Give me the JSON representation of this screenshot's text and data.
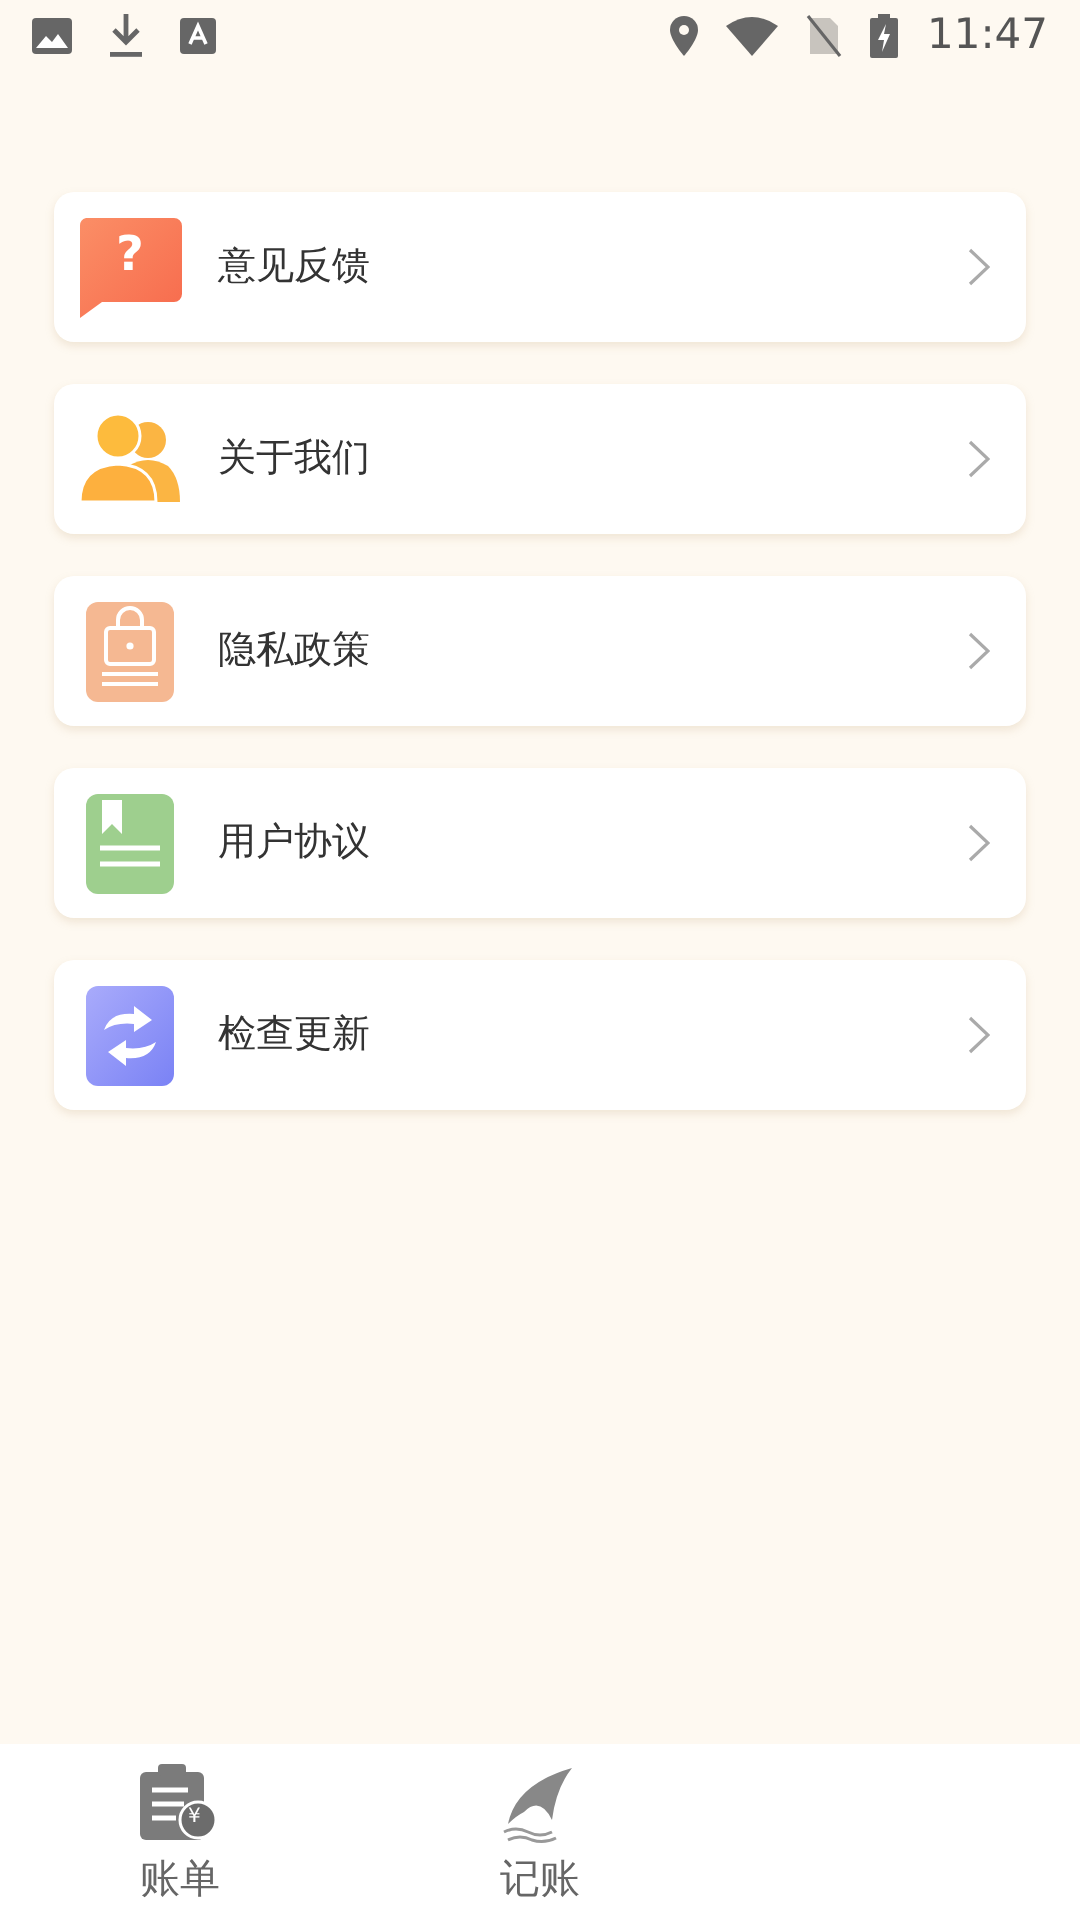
{
  "status_bar": {
    "time": "11:47"
  },
  "menu": [
    {
      "kind": "feedback",
      "label": "意见反馈",
      "glyph": "?"
    },
    {
      "kind": "about",
      "label": "关于我们"
    },
    {
      "kind": "privacy",
      "label": "隐私政策"
    },
    {
      "kind": "agreement",
      "label": "用户协议"
    },
    {
      "kind": "update",
      "label": "检查更新"
    }
  ],
  "tab_bar": [
    {
      "kind": "bill",
      "label": "账单",
      "glyph": "¥"
    },
    {
      "kind": "record",
      "label": "记账"
    }
  ]
}
